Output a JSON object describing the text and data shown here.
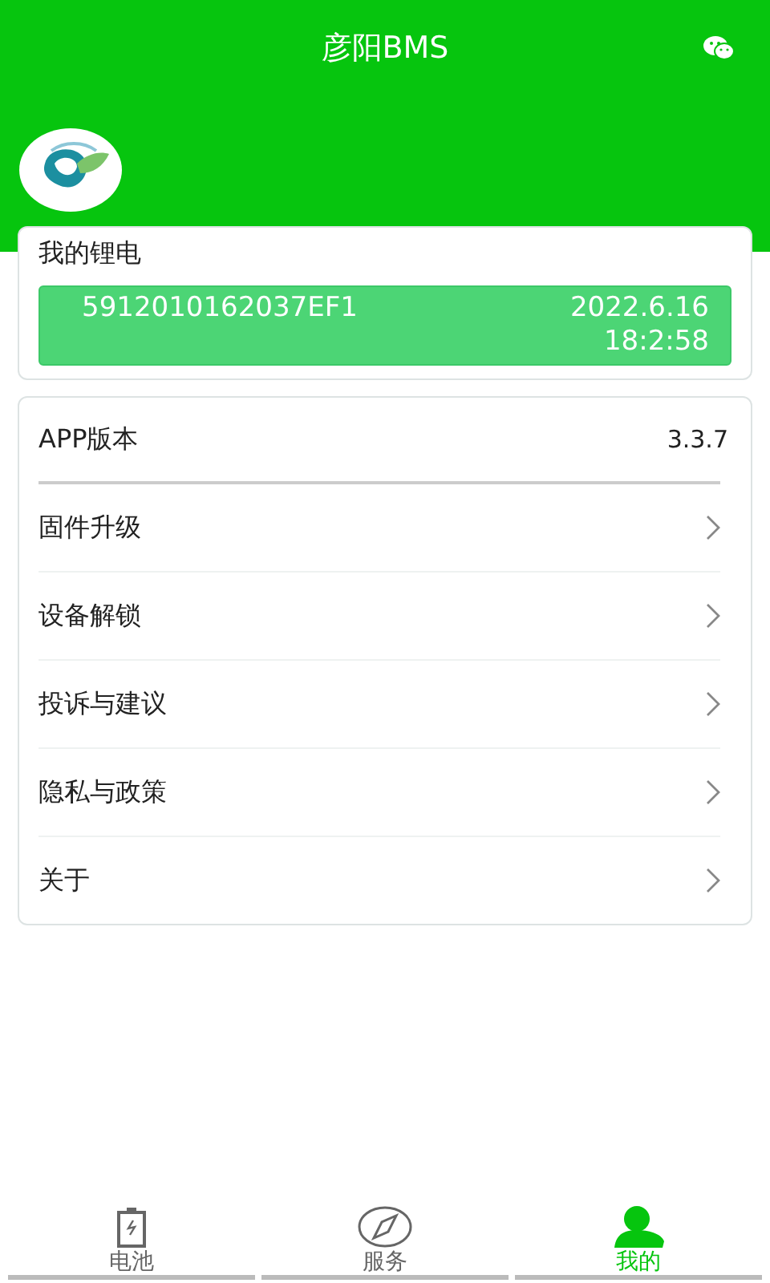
{
  "header": {
    "title": "彦阳BMS"
  },
  "battery_card": {
    "title": "我的锂电",
    "device_id": "5912010162037EF1",
    "date": "2022.6.16",
    "time": "18:2:58"
  },
  "menu": [
    {
      "kind": "value",
      "label": "APP版本",
      "value": "3.3.7"
    },
    {
      "kind": "link",
      "label": "固件升级"
    },
    {
      "kind": "link",
      "label": "设备解锁"
    },
    {
      "kind": "link",
      "label": "投诉与建议"
    },
    {
      "kind": "link",
      "label": "隐私与政策"
    },
    {
      "kind": "link",
      "label": "关于"
    }
  ],
  "tabs": [
    {
      "kind": "battery",
      "label": "电池",
      "selected": false
    },
    {
      "kind": "compass",
      "label": "服务",
      "selected": false
    },
    {
      "kind": "person",
      "label": "我的",
      "selected": true
    }
  ]
}
